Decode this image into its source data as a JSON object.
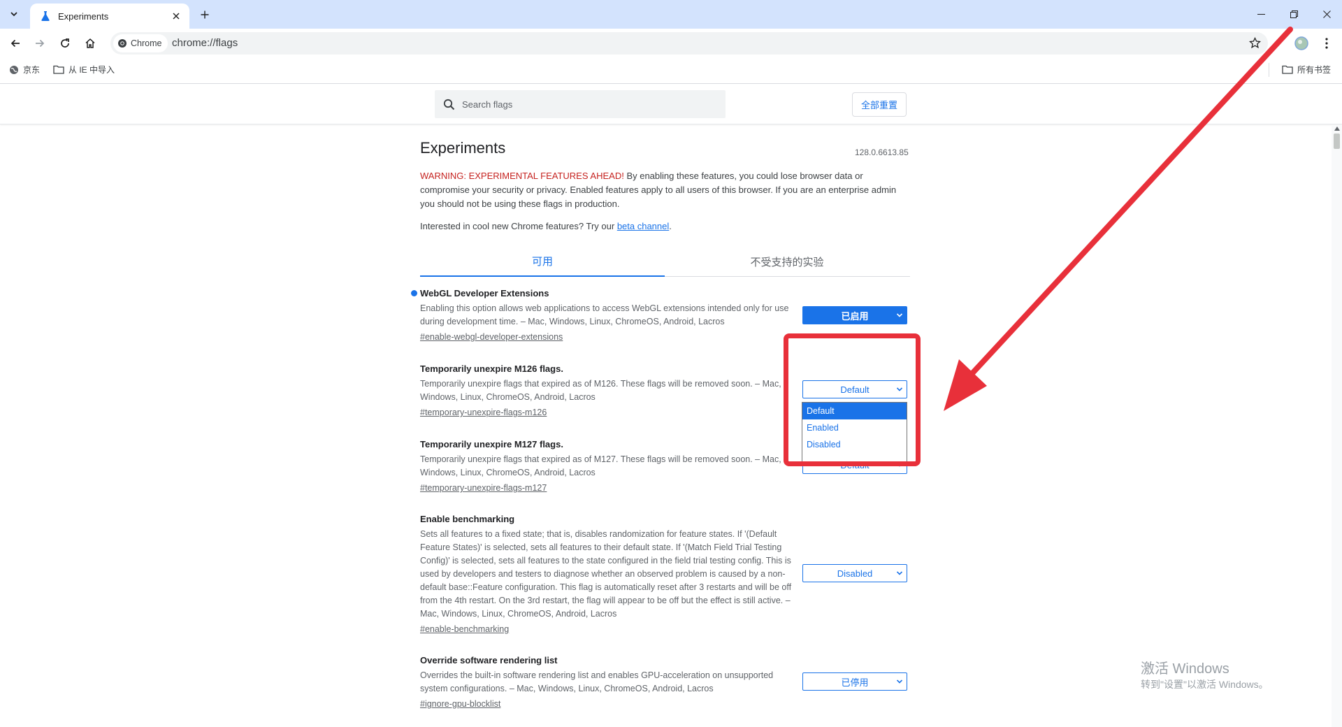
{
  "browser": {
    "tab_title": "Experiments",
    "omnibox_chip": "Chrome",
    "url": "chrome://flags"
  },
  "bookmarks": {
    "items": [
      "京东",
      "从 IE 中导入"
    ],
    "all_bookmarks": "所有书签"
  },
  "header": {
    "search_placeholder": "Search flags",
    "reset_label": "全部重置"
  },
  "page": {
    "title": "Experiments",
    "version": "128.0.6613.85",
    "warning_red": "WARNING: EXPERIMENTAL FEATURES AHEAD!",
    "warning_rest": " By enabling these features, you could lose browser data or compromise your security or privacy. Enabled features apply to all users of this browser. If you are an enterprise admin you should not be using these flags in production.",
    "interest_text": "Interested in cool new Chrome features? Try our ",
    "interest_link": "beta channel",
    "interest_end": ".",
    "tabs": [
      "可用",
      "不受支持的实验"
    ]
  },
  "flags": [
    {
      "name": "WebGL Developer Extensions",
      "description": "Enabling this option allows web applications to access WebGL extensions intended only for use during development time. – Mac, Windows, Linux, ChromeOS, Android, Lacros",
      "link": "#enable-webgl-developer-extensions",
      "value": "已启用"
    },
    {
      "name": "Temporarily unexpire M126 flags.",
      "description": "Temporarily unexpire flags that expired as of M126. These flags will be removed soon. – Mac, Windows, Linux, ChromeOS, Android, Lacros",
      "link": "#temporary-unexpire-flags-m126",
      "value": "Default"
    },
    {
      "name": "Temporarily unexpire M127 flags.",
      "description": "Temporarily unexpire flags that expired as of M127. These flags will be removed soon. – Mac, Windows, Linux, ChromeOS, Android, Lacros",
      "link": "#temporary-unexpire-flags-m127",
      "value": "Default"
    },
    {
      "name": "Enable benchmarking",
      "description": "Sets all features to a fixed state; that is, disables randomization for feature states. If '(Default Feature States)' is selected, sets all features to their default state. If '(Match Field Trial Testing Config)' is selected, sets all features to the state configured in the field trial testing config. This is used by developers and testers to diagnose whether an observed problem is caused by a non-default base::Feature configuration. This flag is automatically reset after 3 restarts and will be off from the 4th restart. On the 3rd restart, the flag will appear to be off but the effect is still active. – Mac, Windows, Linux, ChromeOS, Android, Lacros",
      "link": "#enable-benchmarking",
      "value": "Disabled"
    },
    {
      "name": "Override software rendering list",
      "description": "Overrides the built-in software rendering list and enables GPU-acceleration on unsupported system configurations. – Mac, Windows, Linux, ChromeOS, Android, Lacros",
      "link": "#ignore-gpu-blocklist",
      "value": "已停用"
    }
  ],
  "dropdown_options": [
    "Default",
    "Enabled",
    "Disabled"
  ],
  "dropdown_selected": "Default",
  "watermark": {
    "line1": "激活 Windows",
    "line2": "转到\"设置\"以激活 Windows。"
  },
  "colors": {
    "accent": "#1a73e8",
    "annotation_red": "#e8303a",
    "warning_red": "#c5221f",
    "titlebar": "#d3e3fd"
  }
}
